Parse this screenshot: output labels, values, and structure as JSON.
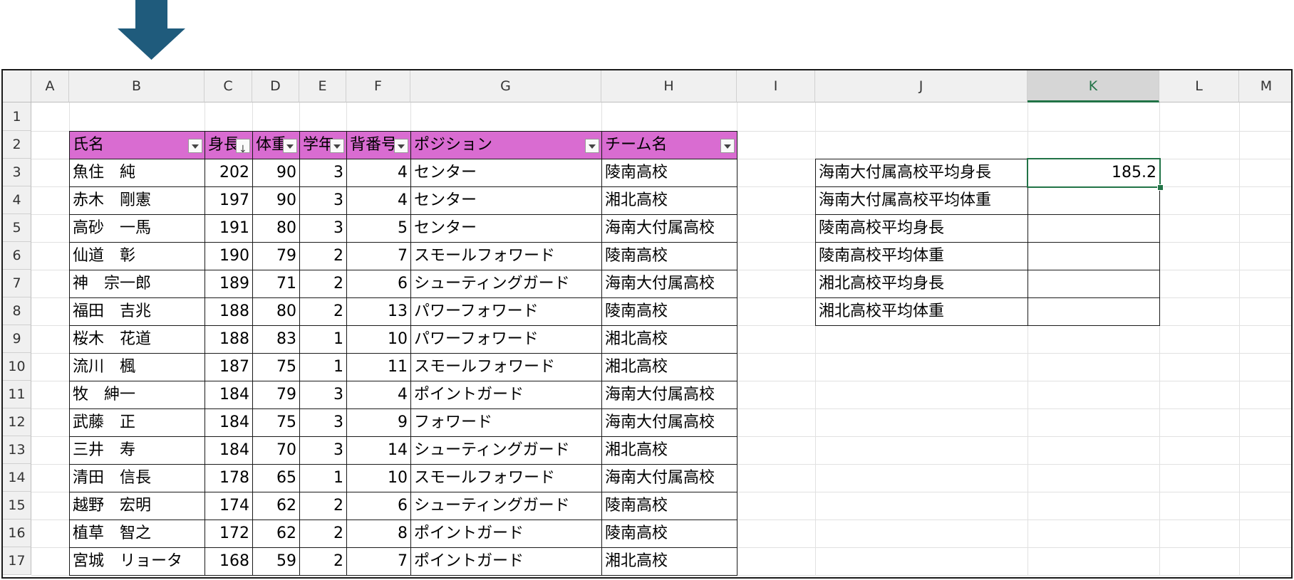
{
  "columns": [
    "A",
    "B",
    "C",
    "D",
    "E",
    "F",
    "G",
    "H",
    "I",
    "J",
    "K",
    "L",
    "M"
  ],
  "rows": [
    "1",
    "2",
    "3",
    "4",
    "5",
    "6",
    "7",
    "8",
    "9",
    "10",
    "11",
    "12",
    "13",
    "14",
    "15",
    "16",
    "17"
  ],
  "selected_column": "K",
  "table": {
    "headers": [
      "氏名",
      "身長",
      "体重",
      "学年",
      "背番号",
      "ポジション",
      "チーム名"
    ],
    "records": [
      [
        "魚住　純",
        "202",
        "90",
        "3",
        "4",
        "センター",
        "陵南高校"
      ],
      [
        "赤木　剛憲",
        "197",
        "90",
        "3",
        "4",
        "センター",
        "湘北高校"
      ],
      [
        "高砂　一馬",
        "191",
        "80",
        "3",
        "5",
        "センター",
        "海南大付属高校"
      ],
      [
        "仙道　彰",
        "190",
        "79",
        "2",
        "7",
        "スモールフォワード",
        "陵南高校"
      ],
      [
        "神　宗一郎",
        "189",
        "71",
        "2",
        "6",
        "シューティングガード",
        "海南大付属高校"
      ],
      [
        "福田　吉兆",
        "188",
        "80",
        "2",
        "13",
        "パワーフォワード",
        "陵南高校"
      ],
      [
        "桜木　花道",
        "188",
        "83",
        "1",
        "10",
        "パワーフォワード",
        "湘北高校"
      ],
      [
        "流川　楓",
        "187",
        "75",
        "1",
        "11",
        "スモールフォワード",
        "湘北高校"
      ],
      [
        "牧　紳一",
        "184",
        "79",
        "3",
        "4",
        "ポイントガード",
        "海南大付属高校"
      ],
      [
        "武藤　正",
        "184",
        "75",
        "3",
        "9",
        "フォワード",
        "海南大付属高校"
      ],
      [
        "三井　寿",
        "184",
        "70",
        "3",
        "14",
        "シューティングガード",
        "湘北高校"
      ],
      [
        "清田　信長",
        "178",
        "65",
        "1",
        "10",
        "スモールフォワード",
        "海南大付属高校"
      ],
      [
        "越野　宏明",
        "174",
        "62",
        "2",
        "6",
        "シューティングガード",
        "陵南高校"
      ],
      [
        "植草　智之",
        "172",
        "62",
        "2",
        "8",
        "ポイントガード",
        "陵南高校"
      ],
      [
        "宮城　リョータ",
        "168",
        "59",
        "2",
        "7",
        "ポイントガード",
        "湘北高校"
      ]
    ]
  },
  "summary": {
    "labels": [
      "海南大付属高校平均身長",
      "海南大付属高校平均体重",
      "陵南高校平均身長",
      "陵南高校平均体重",
      "湘北高校平均身長",
      "湘北高校平均体重"
    ],
    "values": [
      "185.2",
      "",
      "",
      "",
      "",
      ""
    ]
  },
  "colors": {
    "header_fill": "#d96cd1",
    "arrow": "#1f5b7c",
    "selection": "#217346"
  },
  "icons": [
    "down-arrow-icon",
    "filter-dropdown-icon",
    "sort-descending-icon"
  ]
}
